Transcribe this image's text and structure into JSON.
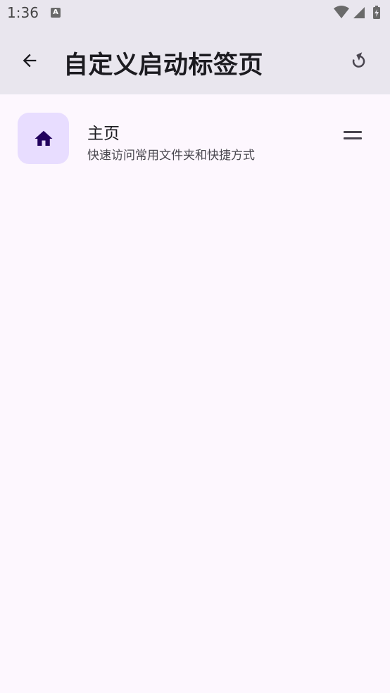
{
  "status_bar": {
    "time": "1:36",
    "notification_icon_letter": "A"
  },
  "app_bar": {
    "title": "自定义启动标签页",
    "back_icon": "arrow-back-icon",
    "reset_icon": "reset-icon"
  },
  "tabs": [
    {
      "title": "主页",
      "subtitle": "快速访问常用文件夹和快捷方式",
      "icon": "home-icon",
      "accent": "#E8DDFF"
    }
  ]
}
